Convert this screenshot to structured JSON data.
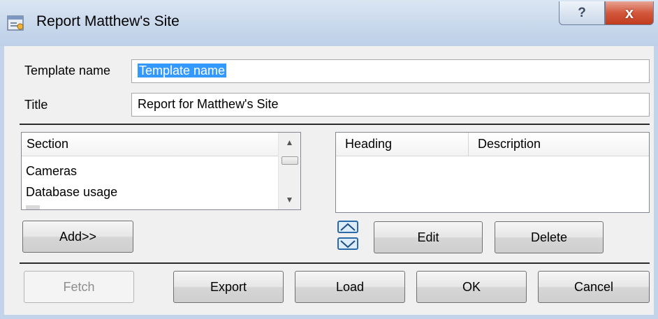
{
  "window": {
    "title": "Report Matthew's Site",
    "help_glyph": "?",
    "close_glyph": "x"
  },
  "form": {
    "template_name_label": "Template name",
    "template_name_value": "Template name",
    "title_label": "Title",
    "title_value": "Report for Matthew's Site"
  },
  "sections": {
    "header": "Section",
    "items": [
      "Cameras",
      "Database usage"
    ]
  },
  "report_items": {
    "columns": [
      "Heading",
      "Description"
    ]
  },
  "buttons": {
    "add": "Add>>",
    "edit": "Edit",
    "delete": "Delete",
    "fetch": "Fetch",
    "export": "Export",
    "load": "Load",
    "ok": "OK",
    "cancel": "Cancel"
  },
  "icons": {
    "window": "report-window-icon",
    "move_up": "move-up-arrow-icon",
    "move_down": "move-down-arrow-icon"
  },
  "colors": {
    "selection": "#3399ff",
    "close_button": "#c94a2e",
    "titlebar": "#c8d8ec"
  }
}
